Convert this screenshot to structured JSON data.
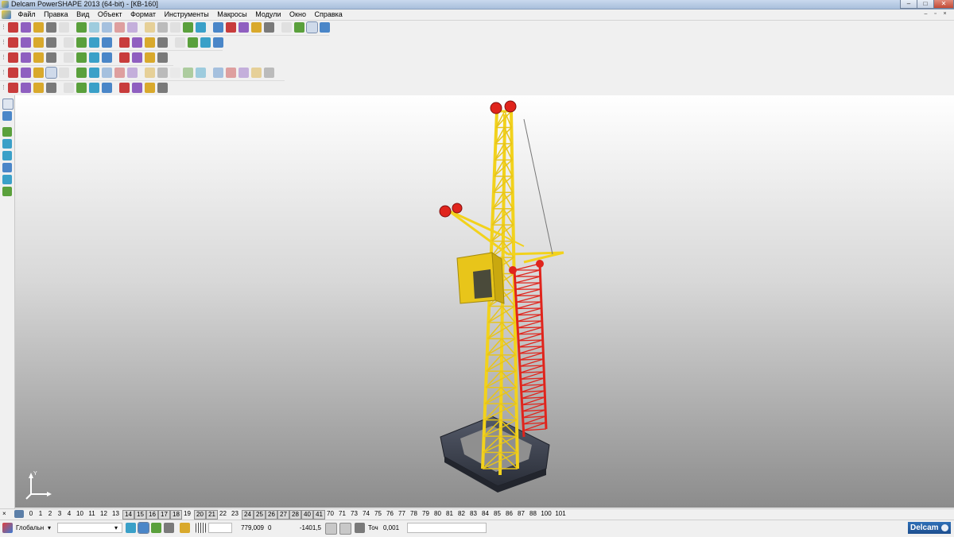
{
  "window": {
    "title": "Delcam PowerSHAPE 2013 (64-bit) - [КВ-160]",
    "minimize_label": "–",
    "maximize_label": "□",
    "close_label": "✕"
  },
  "menubar": {
    "items": [
      "Файл",
      "Правка",
      "Вид",
      "Объект",
      "Формат",
      "Инструменты",
      "Макросы",
      "Модули",
      "Окно",
      "Справка"
    ],
    "mdi_minimize": "–",
    "mdi_restore": "▫",
    "mdi_close": "×"
  },
  "toolbars": {
    "colors": [
      "#4a86c8",
      "#d9a92c",
      "#5aa03c",
      "#c83c3c",
      "#7a7a7a",
      "#3aa0c8",
      "#8f5fc0",
      "#e0e0e0"
    ]
  },
  "viewport": {
    "triad_label": "Y",
    "crane_colors": {
      "mast": "#f2d21c",
      "mast_edge": "#b59a0d",
      "ladder": "#e0241c",
      "base": "#3a3f4c",
      "cab": "#e8c51a"
    }
  },
  "levelbar": {
    "levels": [
      "0",
      "1",
      "2",
      "3",
      "4",
      "10",
      "11",
      "12",
      "13",
      "14",
      "15",
      "16",
      "17",
      "18",
      "19",
      "20",
      "21",
      "22",
      "23",
      "24",
      "25",
      "26",
      "27",
      "28",
      "40",
      "41",
      "70",
      "71",
      "73",
      "74",
      "75",
      "76",
      "77",
      "78",
      "79",
      "80",
      "81",
      "82",
      "83",
      "84",
      "85",
      "86",
      "87",
      "88",
      "100",
      "101"
    ],
    "active_levels": [
      "14",
      "15",
      "16",
      "17",
      "18",
      "20",
      "21",
      "24",
      "25",
      "26",
      "27",
      "28",
      "40",
      "41"
    ]
  },
  "statusbar": {
    "workplane": "Глобальн",
    "dropdown_value": "",
    "x": "779,009",
    "y": "0",
    "z": "-1401,5",
    "tolerance_label": "Точ",
    "tolerance": "0,001",
    "message": "",
    "logo": "Delcam"
  }
}
